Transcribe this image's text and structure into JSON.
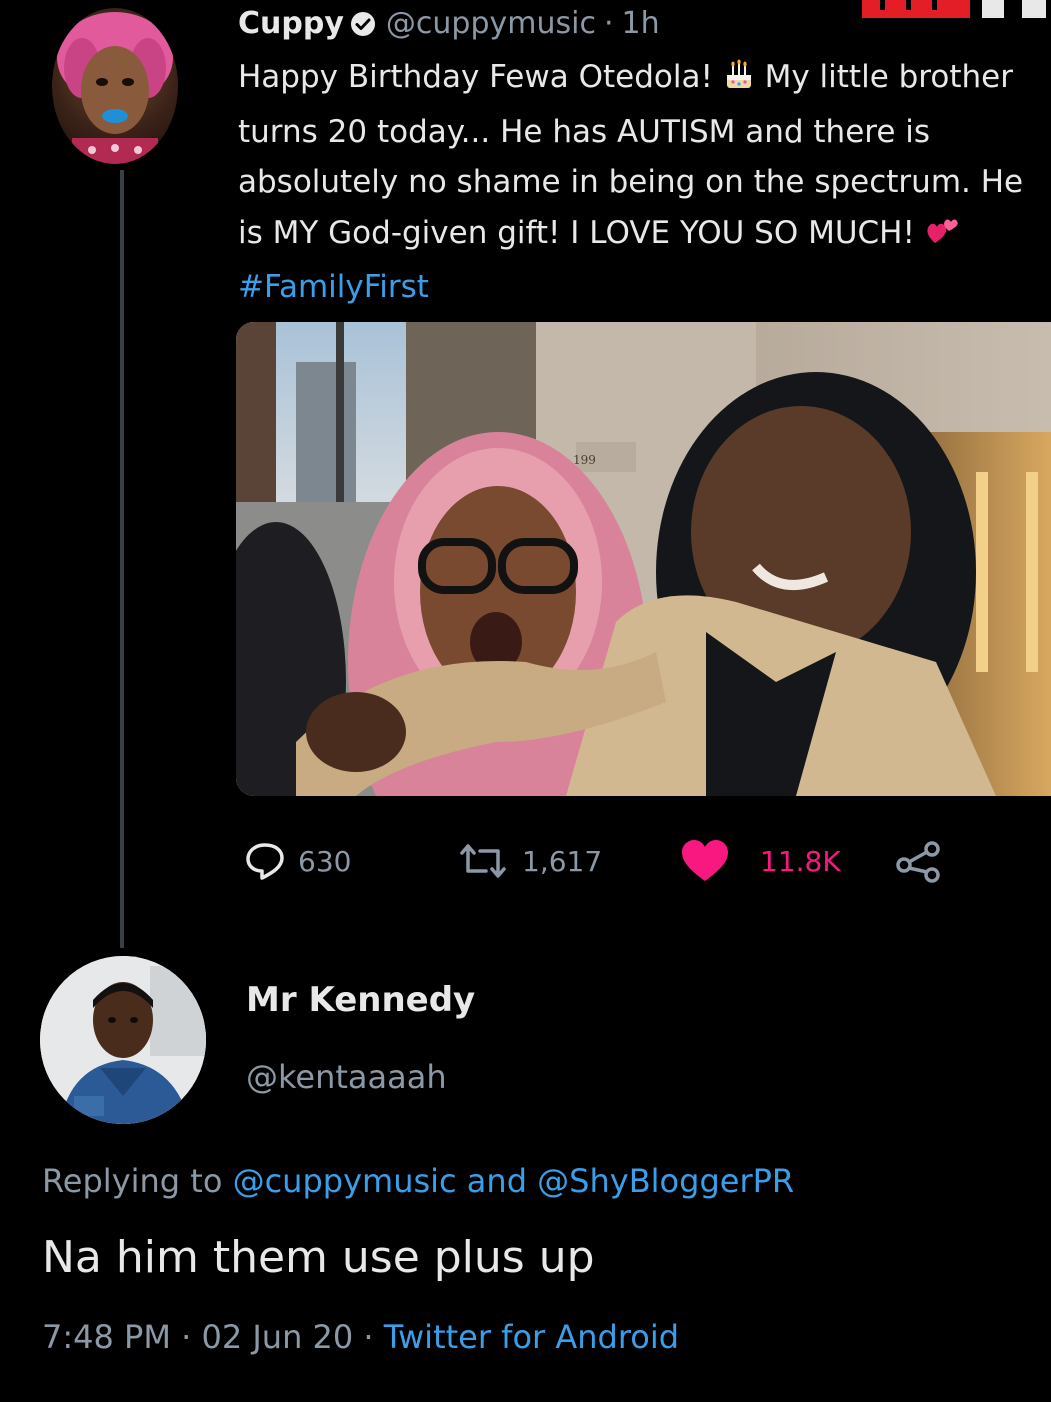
{
  "tweet": {
    "author_name": "Cuppy",
    "author_handle": "@cuppymusic",
    "separator": "·",
    "time": "1h",
    "text_parts": {
      "t1": "Happy Birthday Fewa Otedola! ",
      "t2": " My little brother turns 20 today... He has AUTISM and there is absolutely no shame in being on the spectrum. He is MY God-given gift! I LOVE YOU SO MUCH! ",
      "hashtag": "#FamilyFirst"
    },
    "emoji": {
      "cake": "birthday-cake-emoji",
      "hearts": "two-hearts-emoji"
    },
    "photo": {
      "sign_text": "199"
    },
    "stats": {
      "replies": "630",
      "retweets": "1,617",
      "likes": "11.8K"
    }
  },
  "reply": {
    "author_name": "Mr Kennedy",
    "author_handle": "@kentaaaah",
    "replying_to": {
      "prefix": "Replying to ",
      "handle1": "@cuppymusic",
      "and": " and ",
      "handle2": "@ShyBloggerPR"
    },
    "text": "Na him them use plus up",
    "meta": {
      "time": "7:48 PM",
      "sep1": " · ",
      "date": "02 Jun 20",
      "sep2": " · ",
      "source": "Twitter for Android"
    }
  },
  "icons": {
    "verified": "verified-badge-icon",
    "reply": "reply-icon",
    "retweet": "retweet-icon",
    "like": "heart-icon",
    "share": "share-icon"
  },
  "colors": {
    "background": "#000000",
    "text": "#e8e8e8",
    "muted": "#8b98a5",
    "link": "#3a9ee8",
    "like": "#f91880",
    "thread_line": "#3a3f45"
  }
}
